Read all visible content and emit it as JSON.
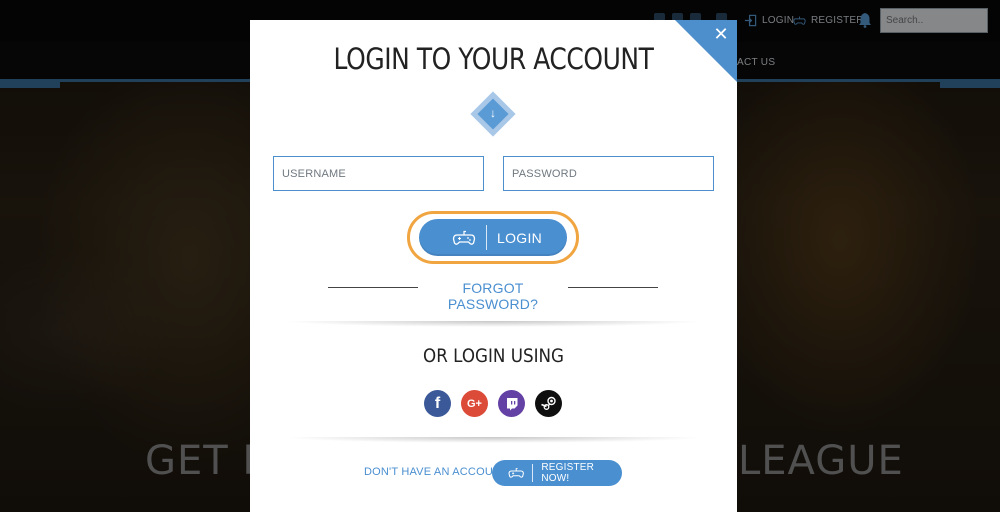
{
  "background": {
    "top_links": {
      "login": "LOGIN",
      "register": "REGISTER"
    },
    "search_placeholder": "Search..",
    "nav_contact": "ACT US",
    "hero_left": "GET RE",
    "hero_right": "LEAGUE"
  },
  "modal": {
    "title": "LOGIN TO YOUR ACCOUNT",
    "close_glyph": "✕",
    "divider_arrow": "↓",
    "username_placeholder": "USERNAME",
    "password_placeholder": "PASSWORD",
    "login_label": "LOGIN",
    "forgot_label": "FORGOT PASSWORD?",
    "or_login_using": "OR LOGIN USING",
    "social": [
      {
        "name": "facebook-icon",
        "glyph": "f",
        "color": "#3b5998"
      },
      {
        "name": "google-plus-icon",
        "glyph": "G+",
        "color": "#dc4a38"
      },
      {
        "name": "twitch-icon",
        "glyph": "",
        "color": "#6441a5"
      },
      {
        "name": "steam-icon",
        "glyph": "",
        "color": "#0f0f0f"
      }
    ],
    "no_account": "DON'T HAVE AN ACCOUNT",
    "register_label": "REGISTER NOW!"
  },
  "colors": {
    "accent": "#4a8fd0",
    "highlight_ring": "#f0a541",
    "navbar_border": "#3a6e99"
  }
}
